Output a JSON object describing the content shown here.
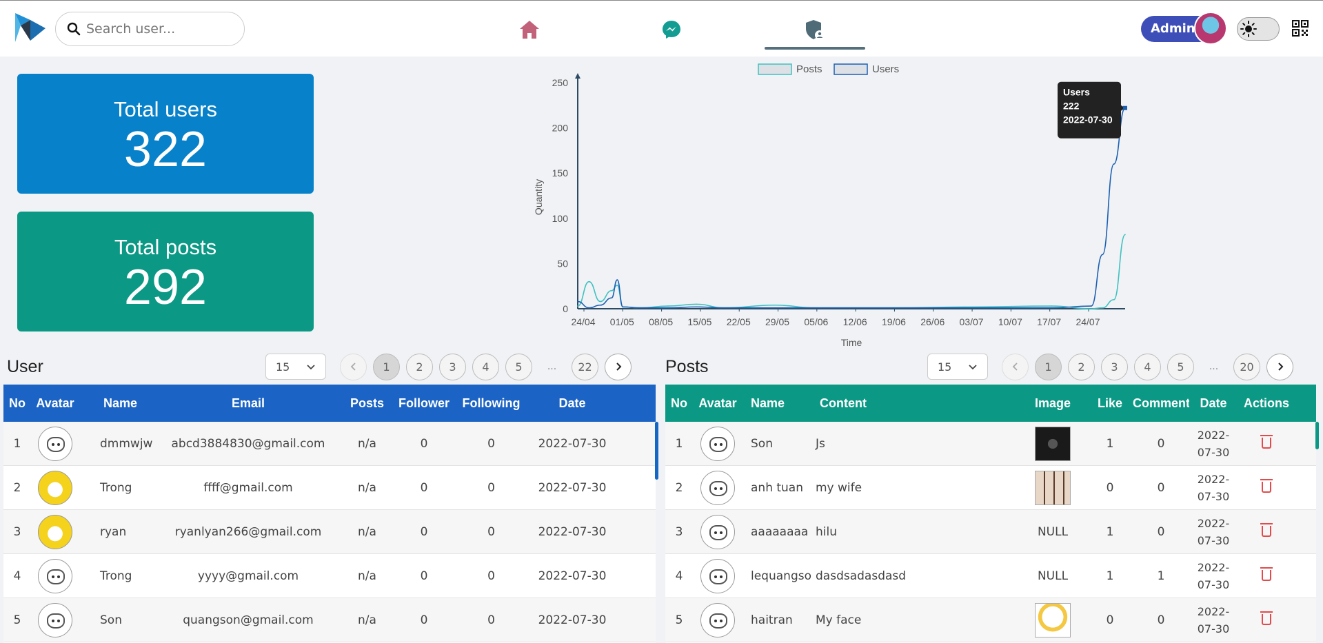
{
  "header": {
    "search_placeholder": "Search user...",
    "admin_label": "Admin",
    "nav": [
      "home-icon",
      "messenger-icon",
      "admin-shield-icon"
    ],
    "active_nav": "admin-shield-icon"
  },
  "stats": {
    "users": {
      "label": "Total users",
      "value": "322",
      "color": "#0781c9"
    },
    "posts": {
      "label": "Total posts",
      "value": "292",
      "color": "#0b9985"
    }
  },
  "chart_data": {
    "type": "line",
    "xlabel": "Time",
    "ylabel": "Quantity",
    "ylim": [
      0,
      250
    ],
    "yticks": [
      0,
      50,
      100,
      150,
      200,
      250
    ],
    "xticks": [
      "24/04",
      "01/05",
      "08/05",
      "15/05",
      "22/05",
      "29/05",
      "05/06",
      "12/06",
      "19/06",
      "26/06",
      "03/07",
      "10/07",
      "17/07",
      "24/07"
    ],
    "x": [
      "2022-04-24",
      "2022-04-26",
      "2022-04-28",
      "2022-04-30",
      "2022-05-01",
      "2022-05-02",
      "2022-05-05",
      "2022-05-10",
      "2022-05-15",
      "2022-05-20",
      "2022-05-29",
      "2022-06-05",
      "2022-06-19",
      "2022-07-03",
      "2022-07-17",
      "2022-07-24",
      "2022-07-26",
      "2022-07-28",
      "2022-07-30"
    ],
    "series": [
      {
        "name": "Posts",
        "color": "#3fc1c0",
        "values": [
          3,
          30,
          8,
          20,
          26,
          2,
          1,
          3,
          5,
          1,
          4,
          1,
          1,
          2,
          3,
          0,
          1,
          10,
          82
        ]
      },
      {
        "name": "Users",
        "color": "#1b5fb3",
        "values": [
          8,
          1,
          4,
          12,
          32,
          2,
          1,
          1,
          2,
          1,
          1,
          1,
          1,
          1,
          1,
          3,
          60,
          160,
          222
        ]
      }
    ],
    "legend_position": "top",
    "tooltip": {
      "series": "Users",
      "value": "222",
      "date": "2022-07-30"
    }
  },
  "users_section": {
    "title": "User",
    "page_size": "15",
    "pages": [
      "1",
      "2",
      "3",
      "4",
      "5"
    ],
    "ellipsis": "...",
    "last_page": "22",
    "header_color": "#1b63c4",
    "columns": [
      "No",
      "Avatar",
      "Name",
      "Email",
      "Posts",
      "Follower",
      "Following",
      "Date"
    ],
    "rows": [
      {
        "no": "1",
        "avatar": "cat-avatar",
        "name": "dmmwjw",
        "email": "abcd3884830@gmail.com",
        "posts": "n/a",
        "follower": "0",
        "following": "0",
        "date": "2022-07-30"
      },
      {
        "no": "2",
        "avatar": "yellow-avatar",
        "name": "Trong",
        "email": "ffff@gmail.com",
        "posts": "n/a",
        "follower": "0",
        "following": "0",
        "date": "2022-07-30"
      },
      {
        "no": "3",
        "avatar": "yellow-avatar",
        "name": "ryan",
        "email": "ryanlyan266@gmail.com",
        "posts": "n/a",
        "follower": "0",
        "following": "0",
        "date": "2022-07-30"
      },
      {
        "no": "4",
        "avatar": "cat-avatar",
        "name": "Trong",
        "email": "yyyy@gmail.com",
        "posts": "n/a",
        "follower": "0",
        "following": "0",
        "date": "2022-07-30"
      },
      {
        "no": "5",
        "avatar": "cat-avatar",
        "name": "Son",
        "email": "quangson@gmail.com",
        "posts": "n/a",
        "follower": "0",
        "following": "0",
        "date": "2022-07-30"
      }
    ]
  },
  "posts_section": {
    "title": "Posts",
    "page_size": "15",
    "pages": [
      "1",
      "2",
      "3",
      "4",
      "5"
    ],
    "ellipsis": "...",
    "last_page": "20",
    "header_color": "#0b9985",
    "columns": [
      "No",
      "Avatar",
      "Name",
      "Content",
      "Image",
      "Like",
      "Comment",
      "Date",
      "Actions"
    ],
    "rows": [
      {
        "no": "1",
        "name": "Son",
        "content": "Js",
        "image": "dark-thumbnail",
        "like": "1",
        "comment": "0",
        "date": "2022-07-30"
      },
      {
        "no": "2",
        "name": "anh tuan",
        "content": "my wife",
        "image": "photo-grid-thumbnail",
        "like": "0",
        "comment": "0",
        "date": "2022-07-30"
      },
      {
        "no": "3",
        "name": "aaaaaaaa",
        "content": "hilu",
        "image": "NULL",
        "like": "1",
        "comment": "0",
        "date": "2022-07-30"
      },
      {
        "no": "4",
        "name": "lequangson",
        "content": "dasdsadasdasd",
        "image": "NULL",
        "like": "1",
        "comment": "1",
        "date": "2022-07-30"
      },
      {
        "no": "5",
        "name": "haitran",
        "content": "My face",
        "image": "face-thumbnail",
        "like": "0",
        "comment": "0",
        "date": "2022-07-30"
      }
    ]
  }
}
